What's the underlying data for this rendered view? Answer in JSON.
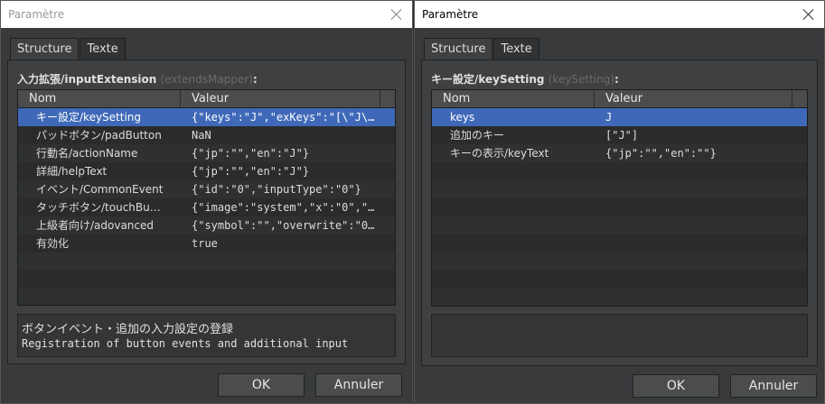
{
  "left_dialog": {
    "title": "Paramètre",
    "tabs": [
      "Structure",
      "Texte"
    ],
    "param_label": "入力拡張/inputExtension",
    "param_sub": "(extendsMapper)",
    "param_colon": ":",
    "columns": [
      "Nom",
      "Valeur"
    ],
    "rows": [
      {
        "name": "キー設定/keySetting",
        "value": "{\"keys\":\"J\",\"exKeys\":\"[\\\"J\\…"
      },
      {
        "name": "パッドボタン/padButton",
        "value": "NaN"
      },
      {
        "name": "行動名/actionName",
        "value": "{\"jp\":\"\",\"en\":\"J\"}"
      },
      {
        "name": "詳細/helpText",
        "value": "{\"jp\":\"\",\"en\":\"J\"}"
      },
      {
        "name": "イベント/CommonEvent",
        "value": "{\"id\":\"0\",\"inputType\":\"0\"}"
      },
      {
        "name": "タッチボタン/touchBu…",
        "value": "{\"image\":\"system\",\"x\":\"0\",\"…"
      },
      {
        "name": "上級者向け/adovanced",
        "value": "{\"symbol\":\"\",\"overwrite\":\"0…"
      },
      {
        "name": "有効化",
        "value": "true"
      }
    ],
    "help_title": "ボタンイベント・追加の入力設定の登録",
    "help_text": "Registration of button events and additional input",
    "ok_label": "OK",
    "cancel_label": "Annuler"
  },
  "right_dialog": {
    "title": "Paramètre",
    "tabs": [
      "Structure",
      "Texte"
    ],
    "param_label": "キー設定/keySetting",
    "param_sub": "(keySetting)",
    "param_colon": ":",
    "columns": [
      "Nom",
      "Valeur"
    ],
    "rows": [
      {
        "name": "keys",
        "value": "J"
      },
      {
        "name": "追加のキー",
        "value": "[\"J\"]"
      },
      {
        "name": "キーの表示/keyText",
        "value": "{\"jp\":\"\",\"en\":\"\"}"
      }
    ],
    "ok_label": "OK",
    "cancel_label": "Annuler"
  },
  "colors": {
    "background": "#383a3c",
    "selection": "#3f69b8",
    "grid": "#2a2c2e"
  }
}
